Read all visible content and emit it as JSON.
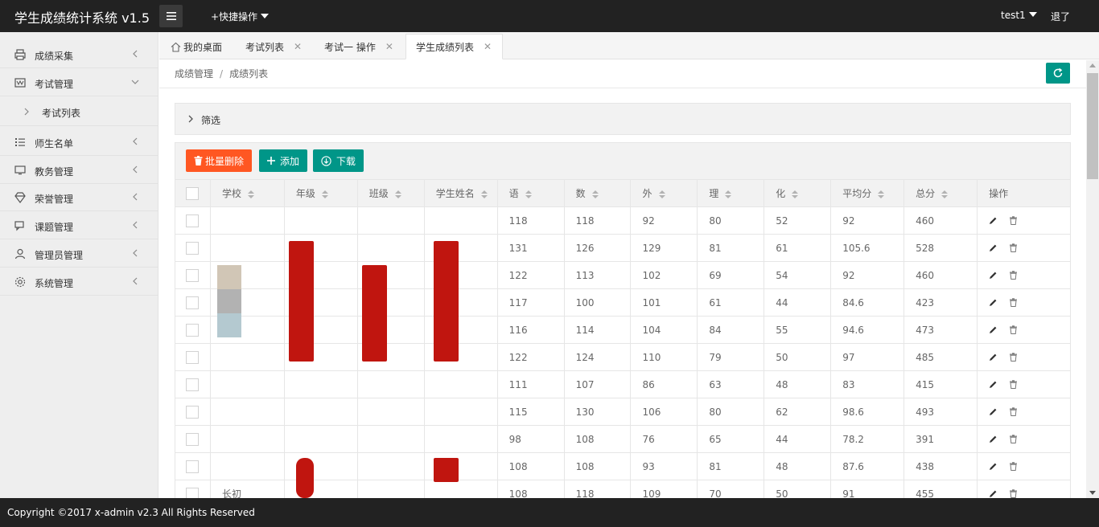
{
  "header": {
    "app_title": "学生成绩统计系统 v1.5",
    "quick_ops": "+快捷操作",
    "user_name": "test1",
    "logout": "退了"
  },
  "sidebar": {
    "items": [
      {
        "label": "成绩采集",
        "icon": "printer-icon"
      },
      {
        "label": "考试管理",
        "icon": "exam-icon"
      },
      {
        "label": "考试列表",
        "icon": "chevron-right-icon"
      },
      {
        "label": "师生名单",
        "icon": "list-icon"
      },
      {
        "label": "教务管理",
        "icon": "monitor-icon"
      },
      {
        "label": "荣誉管理",
        "icon": "diamond-icon"
      },
      {
        "label": "课题管理",
        "icon": "chat-icon"
      },
      {
        "label": "管理员管理",
        "icon": "user-icon"
      },
      {
        "label": "系统管理",
        "icon": "gear-icon"
      }
    ]
  },
  "tabs": [
    {
      "label": "我的桌面"
    },
    {
      "label": "考试列表"
    },
    {
      "label": "考试一 操作"
    },
    {
      "label": "学生成绩列表"
    }
  ],
  "breadcrumb": {
    "root": "成绩管理",
    "sep": "/",
    "current": "成绩列表"
  },
  "filter": {
    "label": "筛选"
  },
  "toolbar": {
    "batch_delete": "批量删除",
    "add": "添加",
    "download": "下载"
  },
  "table": {
    "headers": [
      "学校",
      "年级",
      "班级",
      "学生姓名",
      "语",
      "数",
      "外",
      "理",
      "化",
      "平均分",
      "总分",
      "操作"
    ],
    "rows": [
      {
        "school": "",
        "grade": "",
        "class": "",
        "name": "",
        "yu": "118",
        "shu": "118",
        "wai": "92",
        "li": "80",
        "hua": "52",
        "avg": "92",
        "total": "460"
      },
      {
        "school": "",
        "grade": "",
        "class": "",
        "name": "",
        "yu": "131",
        "shu": "126",
        "wai": "129",
        "li": "81",
        "hua": "61",
        "avg": "105.6",
        "total": "528"
      },
      {
        "school": "",
        "grade": "",
        "class": "",
        "name": "",
        "yu": "122",
        "shu": "113",
        "wai": "102",
        "li": "69",
        "hua": "54",
        "avg": "92",
        "total": "460"
      },
      {
        "school": "",
        "grade": "",
        "class": "",
        "name": "",
        "yu": "117",
        "shu": "100",
        "wai": "101",
        "li": "61",
        "hua": "44",
        "avg": "84.6",
        "total": "423"
      },
      {
        "school": "",
        "grade": "",
        "class": "",
        "name": "",
        "yu": "116",
        "shu": "114",
        "wai": "104",
        "li": "84",
        "hua": "55",
        "avg": "94.6",
        "total": "473"
      },
      {
        "school": "",
        "grade": "",
        "class": "",
        "name": "",
        "yu": "122",
        "shu": "124",
        "wai": "110",
        "li": "79",
        "hua": "50",
        "avg": "97",
        "total": "485"
      },
      {
        "school": "",
        "grade": "",
        "class": "",
        "name": "",
        "yu": "111",
        "shu": "107",
        "wai": "86",
        "li": "63",
        "hua": "48",
        "avg": "83",
        "total": "415"
      },
      {
        "school": "",
        "grade": "",
        "class": "",
        "name": "",
        "yu": "115",
        "shu": "130",
        "wai": "106",
        "li": "80",
        "hua": "62",
        "avg": "98.6",
        "total": "493"
      },
      {
        "school": "",
        "grade": "",
        "class": "",
        "name": "",
        "yu": "98",
        "shu": "108",
        "wai": "76",
        "li": "65",
        "hua": "44",
        "avg": "78.2",
        "total": "391"
      },
      {
        "school": "",
        "grade": "",
        "class": "",
        "name": "",
        "yu": "108",
        "shu": "108",
        "wai": "93",
        "li": "81",
        "hua": "48",
        "avg": "87.6",
        "total": "438"
      },
      {
        "school": "长初",
        "grade": "",
        "class": "",
        "name": "",
        "yu": "108",
        "shu": "118",
        "wai": "109",
        "li": "70",
        "hua": "50",
        "avg": "91",
        "total": "455"
      }
    ]
  },
  "footer": {
    "copyright": "Copyright ©2017 x-admin v2.3 All Rights Reserved"
  },
  "colors": {
    "accent": "#009688",
    "danger": "#ff5722",
    "topbar": "#222222"
  }
}
